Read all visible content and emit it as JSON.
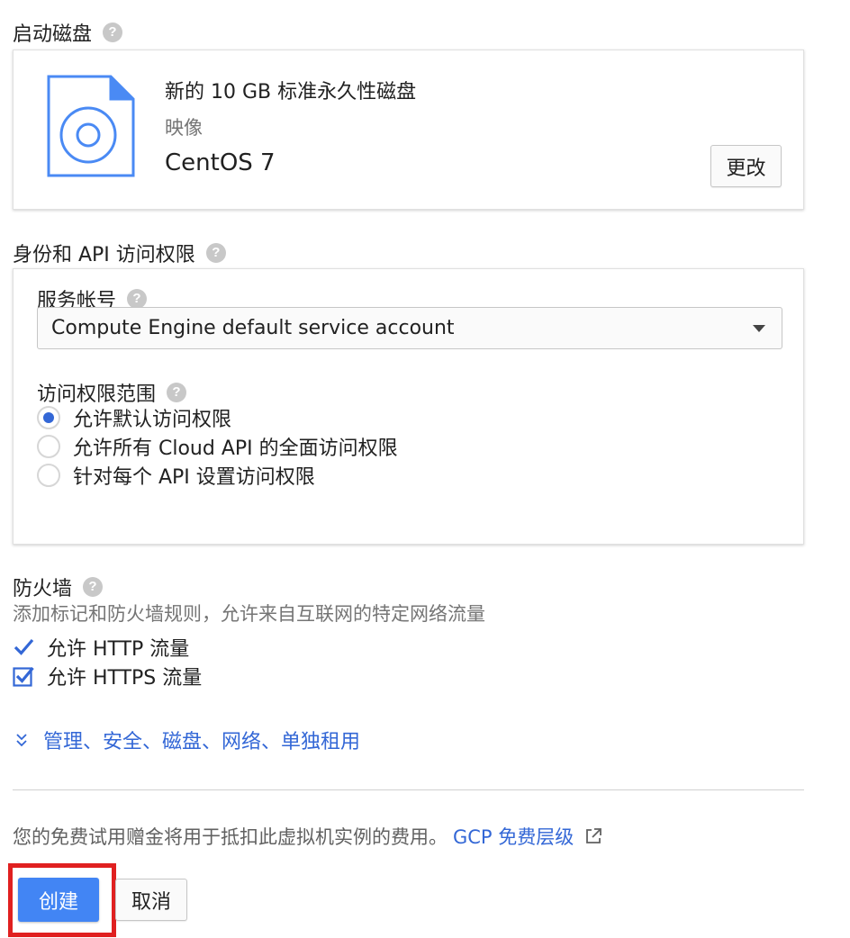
{
  "boot_disk": {
    "title": "启动磁盘",
    "disk_name": "新的 10 GB 标准永久性磁盘",
    "image_label": "映像",
    "image_name": "CentOS 7",
    "change_button": "更改"
  },
  "identity": {
    "title": "身份和 API 访问权限",
    "service_account_label": "服务帐号",
    "service_account_value": "Compute Engine default service account",
    "scopes_label": "访问权限范围",
    "scopes_options": [
      {
        "label": "允许默认访问权限",
        "selected": true
      },
      {
        "label": "允许所有 Cloud API 的全面访问权限",
        "selected": false
      },
      {
        "label": "针对每个 API 设置访问权限",
        "selected": false
      }
    ]
  },
  "firewall": {
    "title": "防火墙",
    "description": "添加标记和防火墙规则，允许来自互联网的特定网络流量",
    "options": [
      {
        "label": "允许 HTTP 流量",
        "checked": true
      },
      {
        "label": "允许 HTTPS 流量",
        "checked": true
      }
    ]
  },
  "advanced_link": "管理、安全、磁盘、网络、单独租用",
  "footer": {
    "notice": "您的免费试用赠金将用于抵扣此虚拟机实例的费用。",
    "tier_link": "GCP 免费层级",
    "create_button": "创建",
    "cancel_button": "取消"
  },
  "help_icon_glyph": "?",
  "colors": {
    "accent": "#3367d6",
    "highlight_border": "#e02020",
    "muted_text": "#757575"
  }
}
